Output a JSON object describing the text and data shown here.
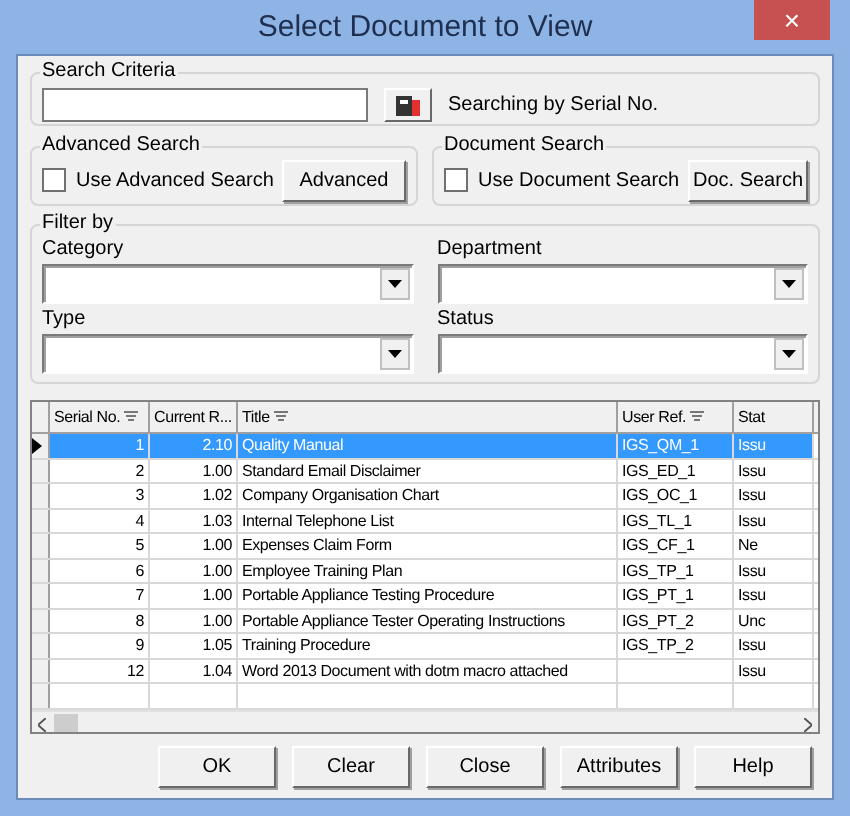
{
  "window": {
    "title": "Select Document to View",
    "close": "×"
  },
  "search_criteria": {
    "legend": "Search Criteria",
    "mode_text": "Searching by Serial No."
  },
  "advanced_search": {
    "legend": "Advanced Search",
    "checkbox": {
      "label": "Use Advanced Search",
      "checked": false
    },
    "button": "Advanced"
  },
  "document_search": {
    "legend": "Document Search",
    "checkbox": {
      "label": "Use Document Search",
      "checked": false
    },
    "button": "Doc. Search"
  },
  "filter": {
    "legend": "Filter by",
    "fields": [
      {
        "label": "Category"
      },
      {
        "label": "Department"
      },
      {
        "label": "Type"
      },
      {
        "label": "Status"
      }
    ]
  },
  "table": {
    "columns": [
      {
        "label": "Serial No.",
        "sort": true
      },
      {
        "label": "Current R..."
      },
      {
        "label": "Title",
        "sort": true
      },
      {
        "label": "User Ref.",
        "sort": true
      },
      {
        "label": "Stat"
      }
    ],
    "rows": [
      {
        "selected": true,
        "cells": [
          "1",
          "2.10",
          "Quality Manual",
          "IGS_QM_1",
          "Issu"
        ]
      },
      {
        "selected": false,
        "cells": [
          "2",
          "1.00",
          "Standard Email Disclaimer",
          "IGS_ED_1",
          "Issu"
        ]
      },
      {
        "selected": false,
        "cells": [
          "3",
          "1.02",
          "Company Organisation Chart",
          "IGS_OC_1",
          "Issu"
        ]
      },
      {
        "selected": false,
        "cells": [
          "4",
          "1.03",
          "Internal Telephone List",
          "IGS_TL_1",
          "Issu"
        ]
      },
      {
        "selected": false,
        "cells": [
          "5",
          "1.00",
          "Expenses Claim Form",
          "IGS_CF_1",
          "Ne"
        ]
      },
      {
        "selected": false,
        "cells": [
          "6",
          "1.00",
          "Employee Training Plan",
          "IGS_TP_1",
          "Issu"
        ]
      },
      {
        "selected": false,
        "cells": [
          "7",
          "1.00",
          "Portable Appliance Testing Procedure",
          "IGS_PT_1",
          "Issu"
        ]
      },
      {
        "selected": false,
        "cells": [
          "8",
          "1.00",
          "Portable Appliance Tester Operating Instructions",
          "IGS_PT_2",
          "Unc"
        ]
      },
      {
        "selected": false,
        "cells": [
          "9",
          "1.05",
          "Training Procedure",
          "IGS_TP_2",
          "Issu"
        ]
      },
      {
        "selected": false,
        "cells": [
          "12",
          "1.04",
          "Word 2013 Document with dotm macro attached",
          "",
          "Issu"
        ]
      }
    ]
  },
  "buttons": [
    "OK",
    "Clear",
    "Close",
    "Attributes",
    "Help"
  ]
}
